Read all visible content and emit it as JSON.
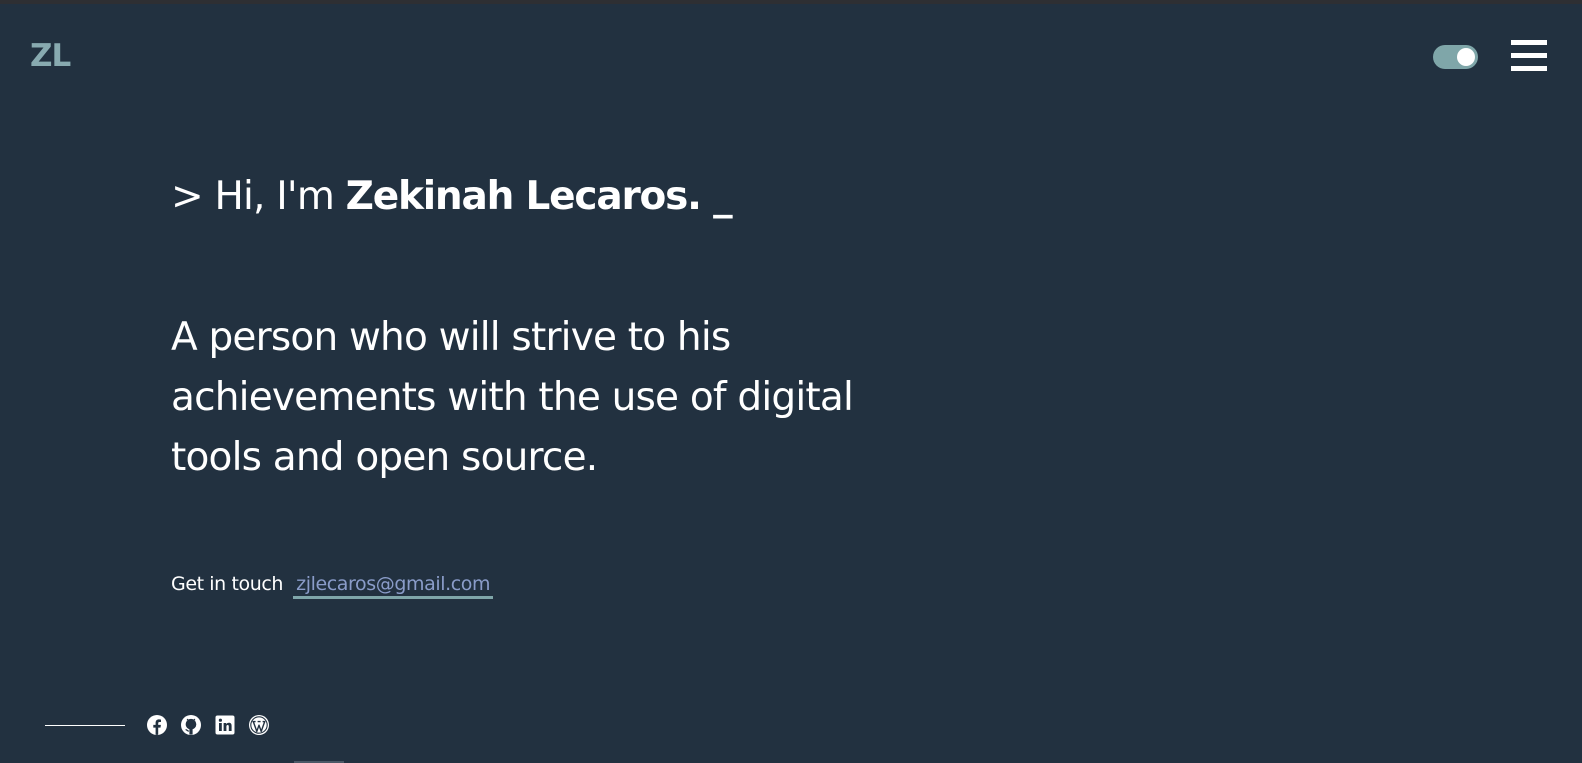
{
  "header": {
    "logo_text": "ZL",
    "theme_toggle": {
      "state": "on",
      "icon": "toggle-switch"
    },
    "menu": {
      "icon": "hamburger-icon"
    }
  },
  "hero": {
    "greeting_prefix": "> Hi, I'm ",
    "name": "Zekinah Lecaros.",
    "cursor": " _",
    "tagline": "A person who will strive to his achievements with the use of digital tools and open source."
  },
  "contact": {
    "label": "Get in touch",
    "email": "zjlecaros@gmail.com"
  },
  "socials": [
    {
      "icon": "facebook-icon"
    },
    {
      "icon": "github-icon"
    },
    {
      "icon": "linkedin-icon"
    },
    {
      "icon": "wordpress-icon"
    }
  ],
  "colors": {
    "background": "#223140",
    "accent": "#7fa6a9",
    "logo": "#88aab0",
    "link": "#8a9cc9",
    "text": "#ffffff"
  }
}
